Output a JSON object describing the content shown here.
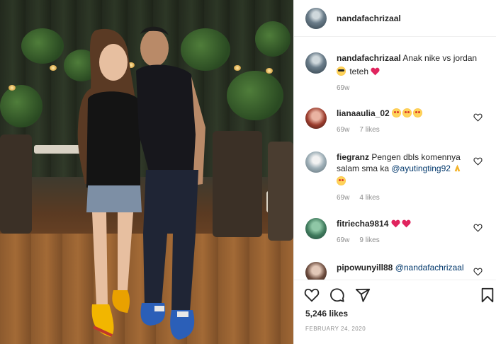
{
  "post": {
    "owner_username": "nandafachrizaal",
    "caption": {
      "username": "nandafachrizaal",
      "text": "Anak nike vs jordan",
      "text2": "teteh",
      "time": "69w"
    },
    "comments": [
      {
        "username": "lianaaulia_02",
        "text": "",
        "time": "69w",
        "likes": "7 likes"
      },
      {
        "username": "fiegranz",
        "text": "Pengen dbls komennya salam sma ka",
        "mention": "@ayutingting92",
        "time": "69w",
        "likes": "4 likes"
      },
      {
        "username": "fitriecha9814",
        "text": "",
        "time": "69w",
        "likes": "9 likes"
      },
      {
        "username": "pipowunyill88",
        "text": "",
        "mention": "@nandafachrizaal",
        "time": "",
        "likes": ""
      }
    ],
    "likes_count": "5,246 likes",
    "date": "FEBRUARY 24, 2020"
  },
  "icons": {
    "like": "heart-outline-icon",
    "comment": "comment-bubble-icon",
    "share": "paper-plane-icon",
    "save": "bookmark-icon"
  },
  "colors": {
    "text": "#262626",
    "muted": "#8e8e8e",
    "mention": "#00376b",
    "heart_red": "#ed4956",
    "border": "#efefef"
  }
}
